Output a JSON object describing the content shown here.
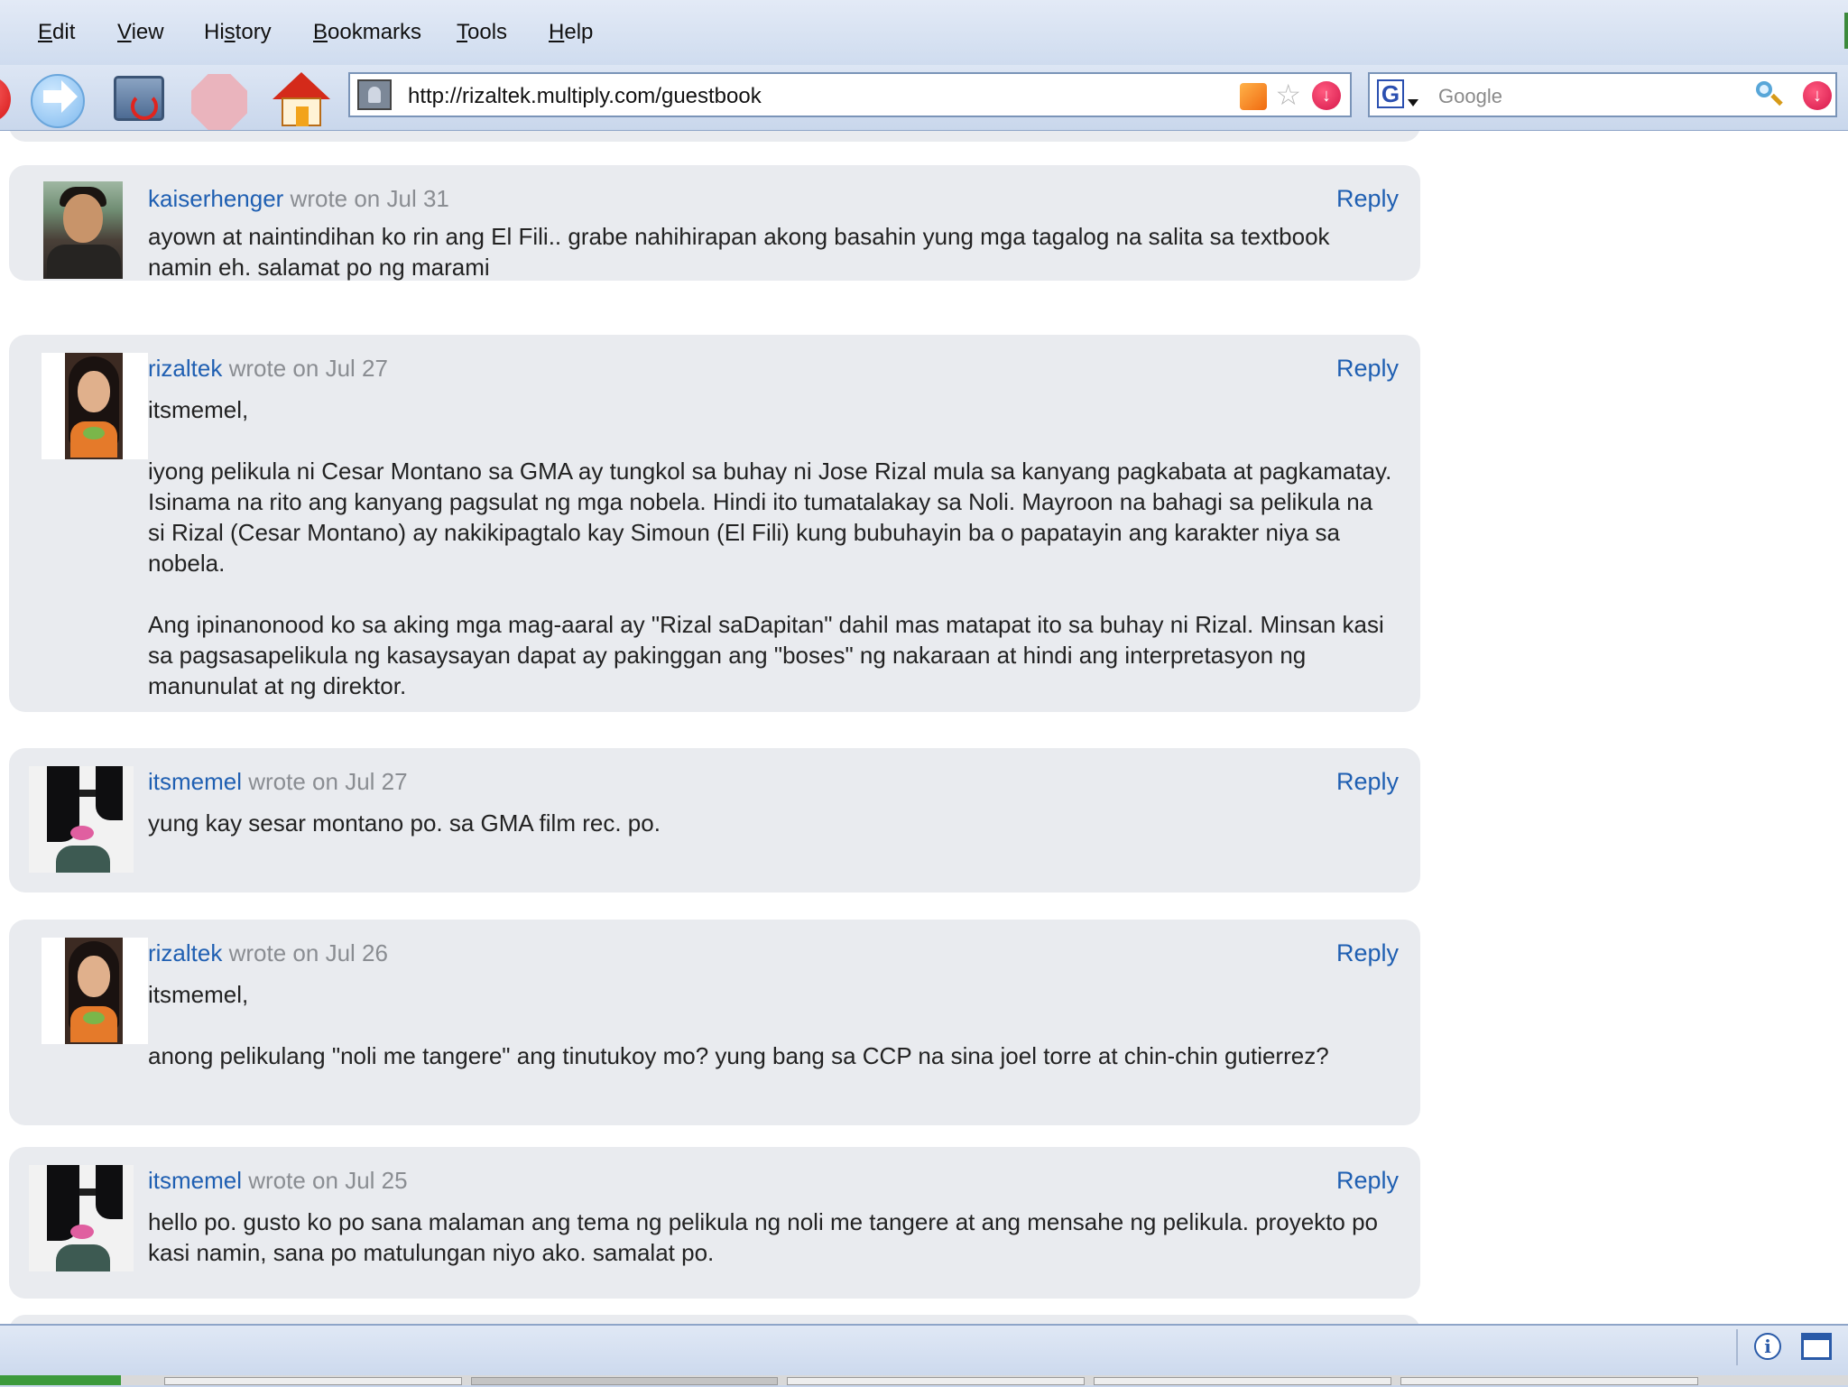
{
  "menu": {
    "items": [
      "Edit",
      "View",
      "History",
      "Bookmarks",
      "Tools",
      "Help"
    ],
    "underline": [
      "E",
      "V",
      "s",
      "B",
      "T",
      "H"
    ]
  },
  "toolbar": {
    "url": "http://rizaltek.multiply.com/guestbook",
    "search_placeholder": "Google",
    "icons": [
      "back-icon",
      "forward-icon",
      "reload-icon",
      "stop-icon",
      "home-icon",
      "site-icon",
      "rss-icon",
      "bookmark-star-icon",
      "dropdown-icon",
      "google-engine-icon",
      "search-icon"
    ]
  },
  "guestbook": {
    "wrote_on": "wrote on",
    "reply_label": "Reply",
    "entries": [
      {
        "author": "kaiserhenger",
        "date": "Jul 31",
        "avatar": "man-avatar",
        "paragraphs": [
          "ayown at naintindihan ko rin ang El Fili.. grabe nahihirapan akong basahin yung mga tagalog na salita sa textbook namin eh. salamat po ng marami"
        ]
      },
      {
        "author": "rizaltek",
        "date": "Jul 27",
        "avatar": "woman-avatar",
        "paragraphs": [
          "itsmemel,",
          "iyong pelikula ni Cesar Montano sa GMA ay tungkol sa buhay ni Jose Rizal mula sa kanyang pagkabata at pagkamatay. Isinama na rito ang kanyang pagsulat ng mga nobela. Hindi ito tumatalakay sa Noli. Mayroon na bahagi sa pelikula na si Rizal (Cesar Montano) ay nakikipagtalo kay Simoun (El Fili) kung bubuhayin ba o papatayin ang karakter niya sa nobela.",
          "Ang ipinanonood ko sa aking mga mag-aaral ay \"Rizal saDapitan\" dahil mas matapat ito sa buhay ni Rizal. Minsan kasi sa pagsasapelikula ng kasaysayan dapat ay pakinggan ang \"boses\" ng nakaraan at hindi ang interpretasyon ng manunulat at ng direktor."
        ]
      },
      {
        "author": "itsmemel",
        "date": "Jul 27",
        "avatar": "emo-avatar",
        "paragraphs": [
          "yung kay sesar montano po. sa GMA film rec. po."
        ]
      },
      {
        "author": "rizaltek",
        "date": "Jul 26",
        "avatar": "woman-avatar",
        "paragraphs": [
          "itsmemel,",
          "anong pelikulang \"noli me tangere\" ang tinutukoy mo? yung bang sa CCP na sina joel torre at chin-chin gutierrez?"
        ]
      },
      {
        "author": "itsmemel",
        "date": "Jul 25",
        "avatar": "emo-avatar",
        "paragraphs": [
          "hello po. gusto ko po sana malaman ang tema ng pelikula ng noli me tangere at ang mensahe ng pelikula. proyekto po kasi namin, sana po matulungan niyo ako. samalat po."
        ]
      }
    ]
  },
  "statusbar": {
    "icons": [
      "info-icon",
      "window-icon"
    ]
  }
}
